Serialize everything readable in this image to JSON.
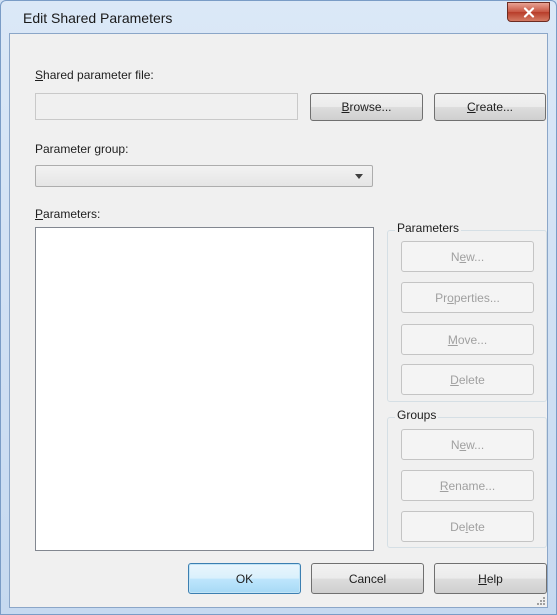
{
  "window": {
    "title": "Edit Shared Parameters"
  },
  "icons": {
    "close": "close-icon",
    "dropdown": "chevron-down-icon",
    "grip": "resize-grip-icon"
  },
  "shared_file": {
    "label_mnemonic": "S",
    "label_rest": "hared parameter file:",
    "value": "",
    "browse_mnemonic": "B",
    "browse_rest": "rowse...",
    "create_mnemonic": "C",
    "create_rest": "reate..."
  },
  "param_group": {
    "label_before": "Parameter ",
    "label_mnemonic": "g",
    "label_after": "roup:",
    "selected": ""
  },
  "parameters_list": {
    "label_mnemonic": "P",
    "label_rest": "arameters:",
    "items": []
  },
  "parameters_box": {
    "title": "Parameters",
    "new_before": "N",
    "new_mnemonic": "e",
    "new_after": "w...",
    "properties_before": "Pr",
    "properties_mnemonic": "o",
    "properties_after": "perties...",
    "move_before": "",
    "move_mnemonic": "M",
    "move_after": "ove...",
    "delete_before": "",
    "delete_mnemonic": "D",
    "delete_after": "elete"
  },
  "groups_box": {
    "title": "Groups",
    "new_before": "N",
    "new_mnemonic": "e",
    "new_after": "w...",
    "rename_before": "",
    "rename_mnemonic": "R",
    "rename_after": "ename...",
    "delete_before": "De",
    "delete_mnemonic": "l",
    "delete_after": "ete"
  },
  "footer": {
    "ok_label": "OK",
    "cancel_label": "Cancel",
    "help_mnemonic": "H",
    "help_rest": "elp"
  }
}
